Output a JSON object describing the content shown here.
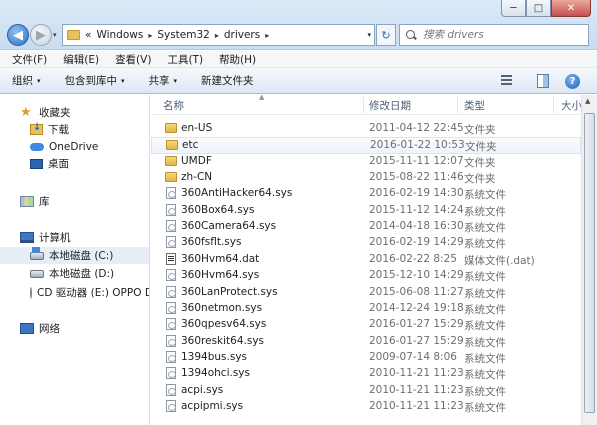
{
  "window": {
    "controls": {
      "minimize": "─",
      "maximize": "□",
      "close": "✕"
    }
  },
  "nav": {
    "back_glyph": "◀",
    "forward_glyph": "▶",
    "history_glyph": "▾"
  },
  "address": {
    "prefix": "«",
    "segments": [
      "Windows",
      "System32",
      "drivers"
    ],
    "separator": "▸",
    "dropdown_glyph": "▾",
    "refresh_glyph": "↻"
  },
  "search": {
    "placeholder": "搜索 drivers"
  },
  "menu": [
    "文件(F)",
    "编辑(E)",
    "查看(V)",
    "工具(T)",
    "帮助(H)"
  ],
  "commands": {
    "organize": "组织",
    "include_in_library": "包含到库中",
    "share": "共享",
    "new_folder": "新建文件夹",
    "caret": "▾",
    "help": "?"
  },
  "navpane": {
    "favorites": "收藏夹",
    "downloads": "下载",
    "onedrive": "OneDrive",
    "desktop": "桌面",
    "libraries": "库",
    "computer": "计算机",
    "drive_c": "本地磁盘 (C:)",
    "drive_d": "本地磁盘 (D:)",
    "drive_e": "CD 驱动器 (E:) OPPO D",
    "network": "网络"
  },
  "columns": {
    "name": "名称",
    "date": "修改日期",
    "type": "类型",
    "size": "大小",
    "sort_glyph": "▲"
  },
  "files": [
    {
      "name": "en-US",
      "date": "2011-04-12 22:45",
      "type": "文件夹",
      "kind": "folder"
    },
    {
      "name": "etc",
      "date": "2016-01-22 10:53",
      "type": "文件夹",
      "kind": "folder"
    },
    {
      "name": "UMDF",
      "date": "2015-11-11 12:07",
      "type": "文件夹",
      "kind": "folder"
    },
    {
      "name": "zh-CN",
      "date": "2015-08-22 11:46",
      "type": "文件夹",
      "kind": "folder"
    },
    {
      "name": "360AntiHacker64.sys",
      "date": "2016-02-19 14:30",
      "type": "系统文件",
      "kind": "sys"
    },
    {
      "name": "360Box64.sys",
      "date": "2015-11-12 14:24",
      "type": "系统文件",
      "kind": "sys"
    },
    {
      "name": "360Camera64.sys",
      "date": "2014-04-18 16:30",
      "type": "系统文件",
      "kind": "sys"
    },
    {
      "name": "360fsflt.sys",
      "date": "2016-02-19 14:29",
      "type": "系统文件",
      "kind": "sys"
    },
    {
      "name": "360Hvm64.dat",
      "date": "2016-02-22 8:25",
      "type": "媒体文件(.dat)",
      "kind": "dat"
    },
    {
      "name": "360Hvm64.sys",
      "date": "2015-12-10 14:29",
      "type": "系统文件",
      "kind": "sys"
    },
    {
      "name": "360LanProtect.sys",
      "date": "2015-06-08 11:27",
      "type": "系统文件",
      "kind": "sys"
    },
    {
      "name": "360netmon.sys",
      "date": "2014-12-24 19:18",
      "type": "系统文件",
      "kind": "sys"
    },
    {
      "name": "360qpesv64.sys",
      "date": "2016-01-27 15:29",
      "type": "系统文件",
      "kind": "sys"
    },
    {
      "name": "360reskit64.sys",
      "date": "2016-01-27 15:29",
      "type": "系统文件",
      "kind": "sys"
    },
    {
      "name": "1394bus.sys",
      "date": "2009-07-14 8:06",
      "type": "系统文件",
      "kind": "sys"
    },
    {
      "name": "1394ohci.sys",
      "date": "2010-11-21 11:23",
      "type": "系统文件",
      "kind": "sys"
    },
    {
      "name": "acpi.sys",
      "date": "2010-11-21 11:23",
      "type": "系统文件",
      "kind": "sys"
    },
    {
      "name": "acpipmi.sys",
      "date": "2010-11-21 11:23",
      "type": "系统文件",
      "kind": "sys"
    }
  ]
}
